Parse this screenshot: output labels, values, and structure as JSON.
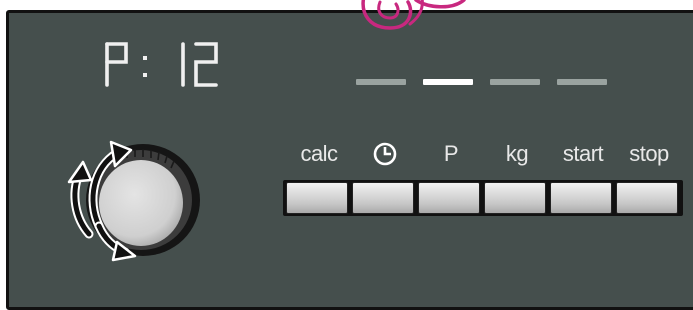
{
  "display": {
    "program_text": "P: 12"
  },
  "indicators": [
    {
      "state": "inactive",
      "color": "#9aa3a0"
    },
    {
      "state": "active",
      "color": "#ffffff"
    },
    {
      "state": "inactive",
      "color": "#9aa3a0"
    },
    {
      "state": "inactive",
      "color": "#9aa3a0"
    }
  ],
  "buttons": [
    {
      "label": "calc",
      "icon": ""
    },
    {
      "label": "",
      "icon": "clock-icon"
    },
    {
      "label": "P",
      "icon": ""
    },
    {
      "label": "kg",
      "icon": ""
    },
    {
      "label": "start",
      "icon": ""
    },
    {
      "label": "stop",
      "icon": ""
    }
  ],
  "colors": {
    "panel": "#454f4d",
    "segment": "#f0f0f0",
    "logo": "#c8287f",
    "button_top": "#f2f2f2",
    "button_bottom": "#a9a9a9"
  }
}
